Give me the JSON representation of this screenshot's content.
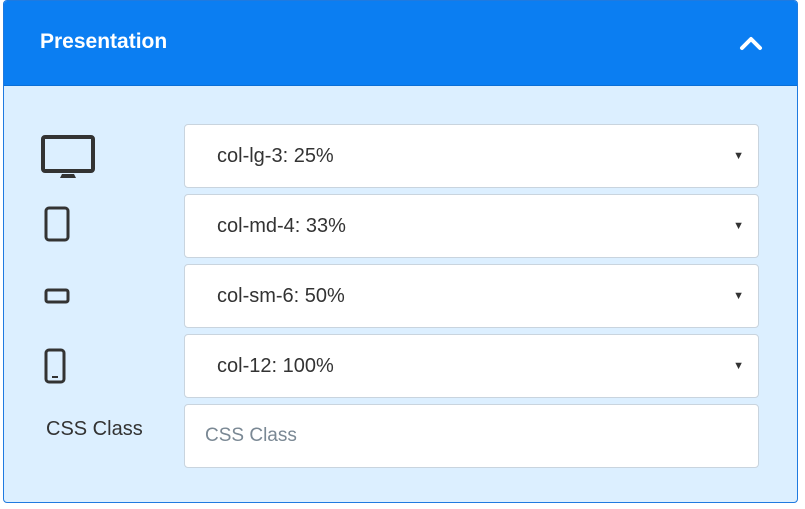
{
  "panel": {
    "title": "Presentation",
    "collapse_icon": "chevron-up-icon"
  },
  "breakpoints": [
    {
      "device": "desktop",
      "icon": "desktop-monitor-icon",
      "value": "col-lg-3: 25%"
    },
    {
      "device": "tablet-portrait",
      "icon": "tablet-portrait-icon",
      "value": "col-md-4: 33%"
    },
    {
      "device": "tablet-landscape",
      "icon": "tablet-landscape-icon",
      "value": "col-sm-6: 50%"
    },
    {
      "device": "phone",
      "icon": "phone-icon",
      "value": "col-12: 100%"
    }
  ],
  "css_class": {
    "label": "CSS Class",
    "value": "",
    "placeholder": "CSS Class"
  },
  "colors": {
    "header_bg": "#0b7ef2",
    "body_bg": "#dcefff",
    "border": "#1f7ae0"
  }
}
